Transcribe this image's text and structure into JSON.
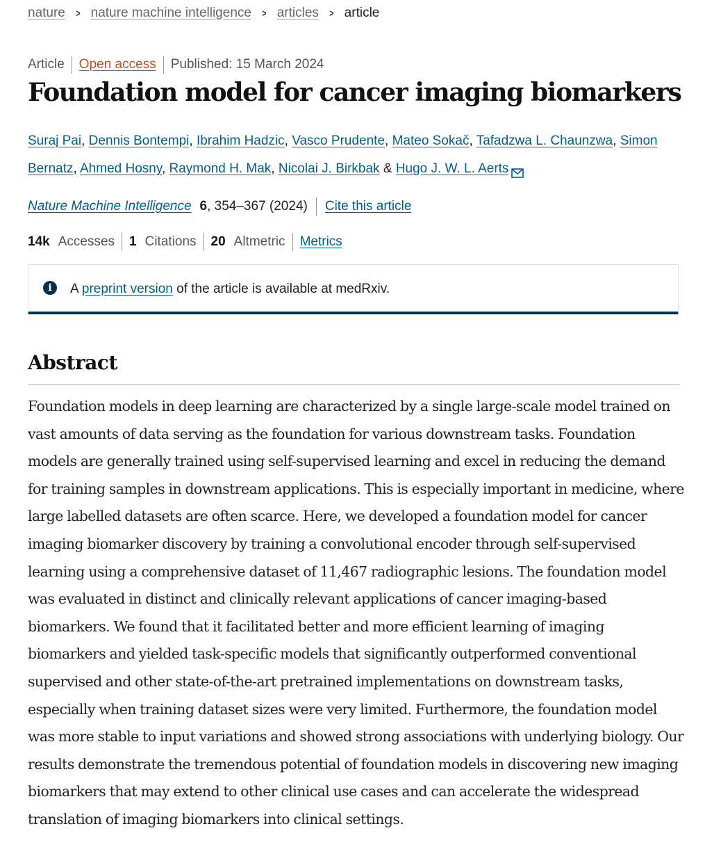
{
  "breadcrumb": {
    "items": [
      "nature",
      "nature machine intelligence",
      "articles"
    ],
    "current": "article"
  },
  "meta": {
    "type": "Article",
    "access": "Open access",
    "published": "Published: 15 March 2024"
  },
  "title": "Foundation model for cancer imaging biomarkers",
  "authors": {
    "list": [
      "Suraj Pai",
      "Dennis Bontempi",
      "Ibrahim Hadzic",
      "Vasco Prudente",
      "Mateo Sokač",
      "Tafadzwa L. Chaunzwa",
      "Simon Bernatz",
      "Ahmed Hosny",
      "Raymond H. Mak",
      "Nicolai J. Birkbak",
      "Hugo J. W. L. Aerts"
    ],
    "conjunction": "&"
  },
  "citation": {
    "journal": "Nature Machine Intelligence",
    "volume": "6",
    "pages_year": ", 354–367 (2024)",
    "cite_link": "Cite this article"
  },
  "metrics": {
    "accesses_value": "14k",
    "accesses_label": "Accesses",
    "citations_value": "1",
    "citations_label": "Citations",
    "altmetric_value": "20",
    "altmetric_label": "Altmetric",
    "metrics_link": "Metrics"
  },
  "notice": {
    "icon": "info-icon",
    "prefix": "A",
    "link": "preprint version",
    "suffix": "of the article is available at medRxiv."
  },
  "abstract": {
    "heading": "Abstract",
    "text": "Foundation models in deep learning are characterized by a single large-scale model trained on vast amounts of data serving as the foundation for various downstream tasks. Foundation models are generally trained using self-supervised learning and excel in reducing the demand for training samples in downstream applications. This is especially important in medicine, where large labelled datasets are often scarce. Here, we developed a foundation model for cancer imaging biomarker discovery by training a convolutional encoder through self-supervised learning using a comprehensive dataset of 11,467 radiographic lesions. The foundation model was evaluated in distinct and clinically relevant applications of cancer imaging-based biomarkers. We found that it facilitated better and more efficient learning of imaging biomarkers and yielded task-specific models that significantly outperformed conventional supervised and other state-of-the-art pretrained implementations on downstream tasks, especially when training dataset sizes were very limited. Furthermore, the foundation model was more stable to input variations and showed strong associations with underlying biology. Our results demonstrate the tremendous potential of foundation models in discovering new imaging biomarkers that may extend to other clinical use cases and can accelerate the widespread translation of imaging biomarkers into clinical settings."
  },
  "colors": {
    "link": "#025e8d",
    "open_access": "#c0502a",
    "notice_border": "#01324b"
  }
}
